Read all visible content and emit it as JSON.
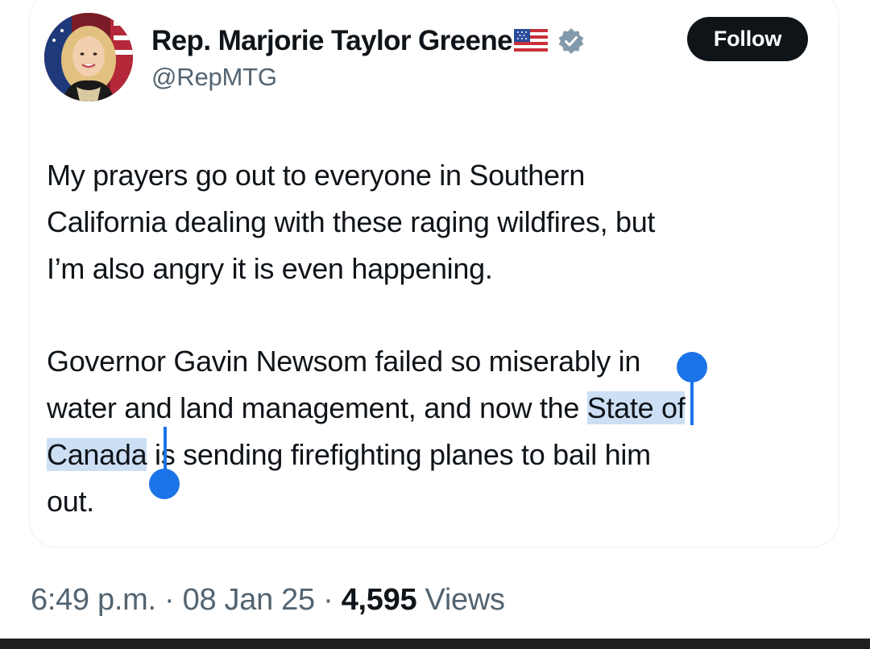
{
  "author": {
    "display_name": "Rep. Marjorie Taylor Greene",
    "handle": "@RepMTG",
    "flag_icon": "us-flag-emoji",
    "verified_icon": "verified-badge-gray"
  },
  "follow_label": "Follow",
  "tweet": {
    "para1": [
      "My prayers go out to everyone in Southern",
      "California dealing with these raging wildfires, but",
      "I’m also angry it is even happening."
    ],
    "para2": {
      "line1": "Governor Gavin Newsom failed so miserably in",
      "line2_before": "water and land management, and now the ",
      "line2_selected": "State of",
      "line3_selected": "Canada",
      "line3_after": " is sending firefighting planes to bail him",
      "line4": "out."
    }
  },
  "meta": {
    "time": "6:49 p.m.",
    "sep1": " · ",
    "date": "08 Jan 25",
    "sep2": " · ",
    "views_count": "4,595",
    "views_label": " Views"
  },
  "colors": {
    "selection": "#1b73e8",
    "follow_bg": "#0f1419",
    "secondary_text": "#536471"
  }
}
